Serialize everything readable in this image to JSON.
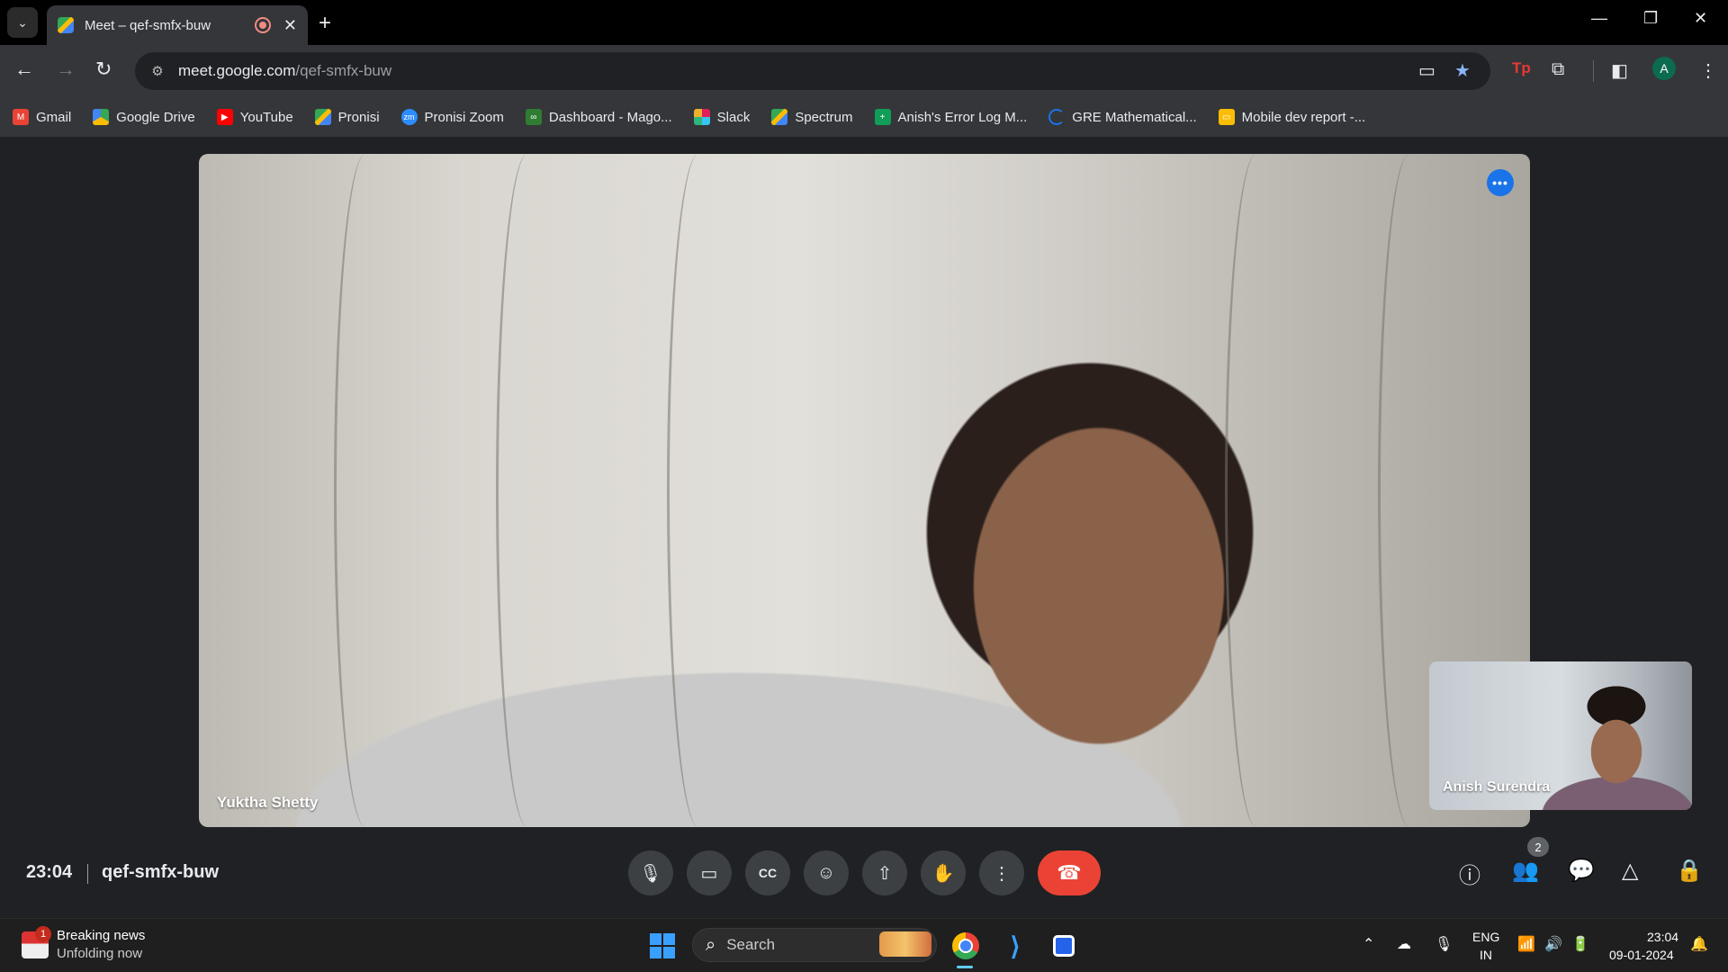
{
  "browser": {
    "tab": {
      "title": "Meet – qef-smfx-buw"
    },
    "omnibox": {
      "host": "meet.google.com",
      "path": "/qef-smfx-buw"
    },
    "profile_initial": "A",
    "bookmarks": [
      {
        "label": "Gmail",
        "icon": "gmail-icon",
        "color": "#ea4335"
      },
      {
        "label": "Google Drive",
        "icon": "drive-icon",
        "color": "#34a853"
      },
      {
        "label": "YouTube",
        "icon": "youtube-icon",
        "color": "#ff0000"
      },
      {
        "label": "Pronisi",
        "icon": "meet-icon",
        "color": "#00897b"
      },
      {
        "label": "Pronisi Zoom",
        "icon": "zoom-icon",
        "color": "#2d8cff"
      },
      {
        "label": "Dashboard - Mago...",
        "icon": "dashboard-icon",
        "color": "#2e7d32"
      },
      {
        "label": "Slack",
        "icon": "slack-icon",
        "color": "#e01e5a"
      },
      {
        "label": "Spectrum",
        "icon": "meet-icon",
        "color": "#00897b"
      },
      {
        "label": "Anish's Error Log M...",
        "icon": "sheets-icon",
        "color": "#0f9d58"
      },
      {
        "label": "GRE Mathematical...",
        "icon": "loader-icon",
        "color": "#1a73e8"
      },
      {
        "label": "Mobile dev report -...",
        "icon": "slides-icon",
        "color": "#fbbc04"
      }
    ]
  },
  "meet": {
    "main_participant": "Yuktha Shetty",
    "self_participant": "Anish Surendra",
    "time": "23:04",
    "meeting_code": "qef-smfx-buw",
    "participants_count": "2",
    "accent": "#1a73e8",
    "end_call_color": "#ea4335"
  },
  "taskbar": {
    "news_count": "1",
    "news_title": "Breaking news",
    "news_subtitle": "Unfolding now",
    "search_placeholder": "Search",
    "lang_line1": "ENG",
    "lang_line2": "IN",
    "clock_time": "23:04",
    "clock_date": "09-01-2024"
  }
}
